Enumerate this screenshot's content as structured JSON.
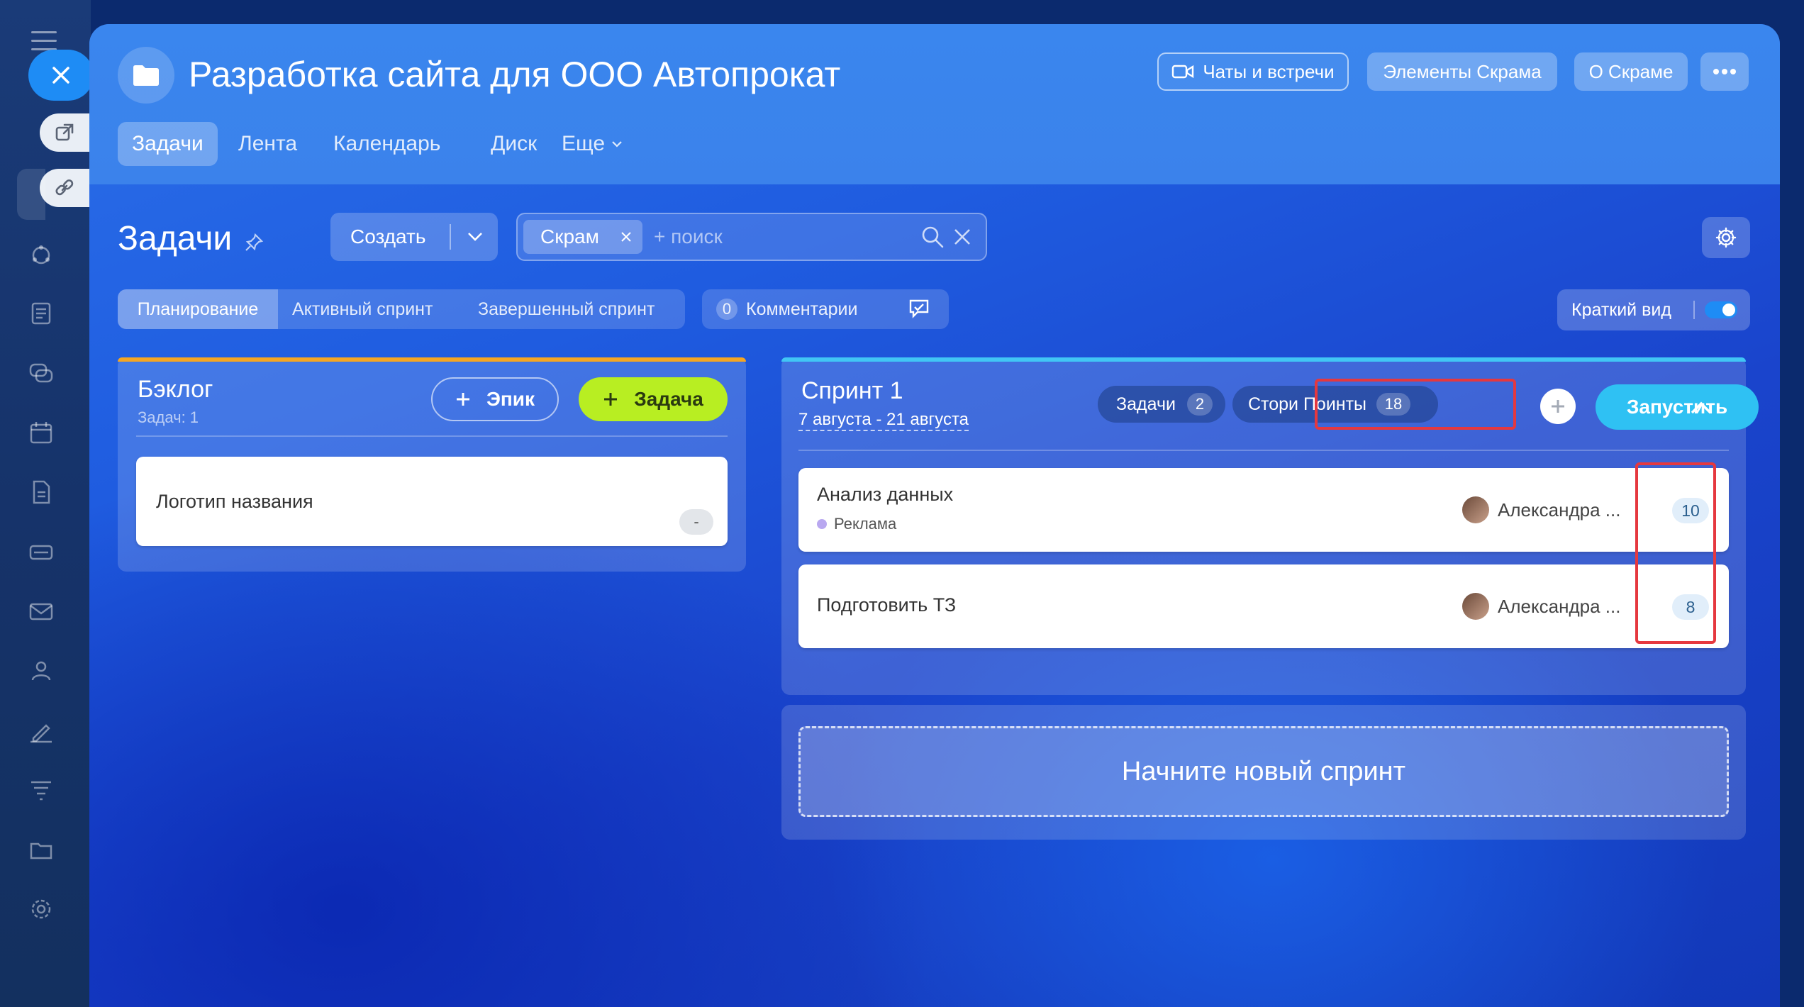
{
  "sidebar": {
    "close_icon": "close-icon",
    "items": [
      "external-link-icon",
      "link-icon",
      "tasks-icon",
      "feed-icon",
      "chat-icon",
      "calendar-icon",
      "document-icon",
      "drive-icon",
      "mail-icon",
      "users-icon",
      "sign-icon",
      "filter-icon",
      "folder-icon",
      "settings-icon"
    ]
  },
  "header": {
    "title": "Разработка сайта для ООО Автопрокат",
    "buttons": {
      "chats": "Чаты и встречи",
      "scrum_elements": "Элементы Скрама",
      "about_scrum": "О Скраме"
    },
    "tabs": [
      "Задачи",
      "Лента",
      "Календарь",
      "Диск",
      "Еще"
    ]
  },
  "toolbar": {
    "page_title": "Задачи",
    "create_label": "Создать",
    "filter_tag": "Скрам",
    "search_placeholder": "+ поиск"
  },
  "view_tabs": {
    "items": [
      "Планирование",
      "Активный спринт",
      "Завершенный спринт"
    ],
    "comments_count": "0",
    "comments_label": "Комментарии",
    "compact_label": "Краткий вид"
  },
  "backlog": {
    "title": "Бэклог",
    "subtitle": "Задач: 1",
    "epic_button": "Эпик",
    "task_button": "Задача",
    "tasks": [
      {
        "title": "Логотип названия",
        "points": "-"
      }
    ]
  },
  "sprint": {
    "title": "Спринт 1",
    "dates": "7 августа - 21 августа",
    "tasks_label": "Задачи",
    "tasks_count": "2",
    "story_points_label": "Стори Поинты",
    "story_points_count": "18",
    "start_button": "Запустить",
    "tasks": [
      {
        "title": "Анализ данных",
        "tag": "Реклама",
        "assignee": "Александра ...",
        "points": "10"
      },
      {
        "title": "Подготовить ТЗ",
        "tag": "",
        "assignee": "Александра ...",
        "points": "8"
      }
    ]
  },
  "new_sprint": {
    "label": "Начните новый спринт"
  },
  "colors": {
    "accent_green": "#b8ee22",
    "accent_cyan": "#2fc1f3",
    "highlight_red": "#e5383f",
    "backlog_bar": "#f5a623",
    "sprint_bar": "#41c6f5"
  }
}
